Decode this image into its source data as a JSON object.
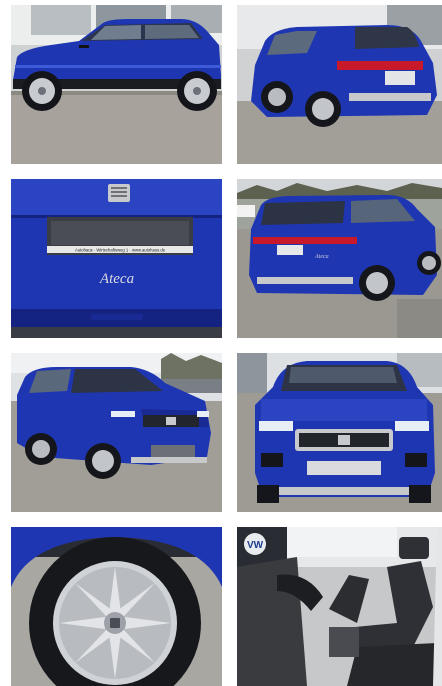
{
  "gallery": {
    "photos": [
      {
        "view": "side-left"
      },
      {
        "view": "rear-three-quarter-left"
      },
      {
        "view": "tailgate-detail",
        "model_badge": "Ateca",
        "plate_frame": "Autohaus · Wirtschaftsweg 1 · www.autohaus.de"
      },
      {
        "view": "rear-three-quarter-left-outdoor",
        "model_badge": "Ateca"
      },
      {
        "view": "front-three-quarter-left"
      },
      {
        "view": "front"
      },
      {
        "view": "wheel-detail"
      },
      {
        "view": "interior-front-seats"
      }
    ]
  },
  "colors": {
    "body_blue": "#1f36b3",
    "body_blue_dark": "#142382",
    "body_blue_light": "#3d5ad8",
    "tail_red": "#c8192a",
    "asphalt": "#9b9891",
    "sky": "#dfe3e6"
  }
}
